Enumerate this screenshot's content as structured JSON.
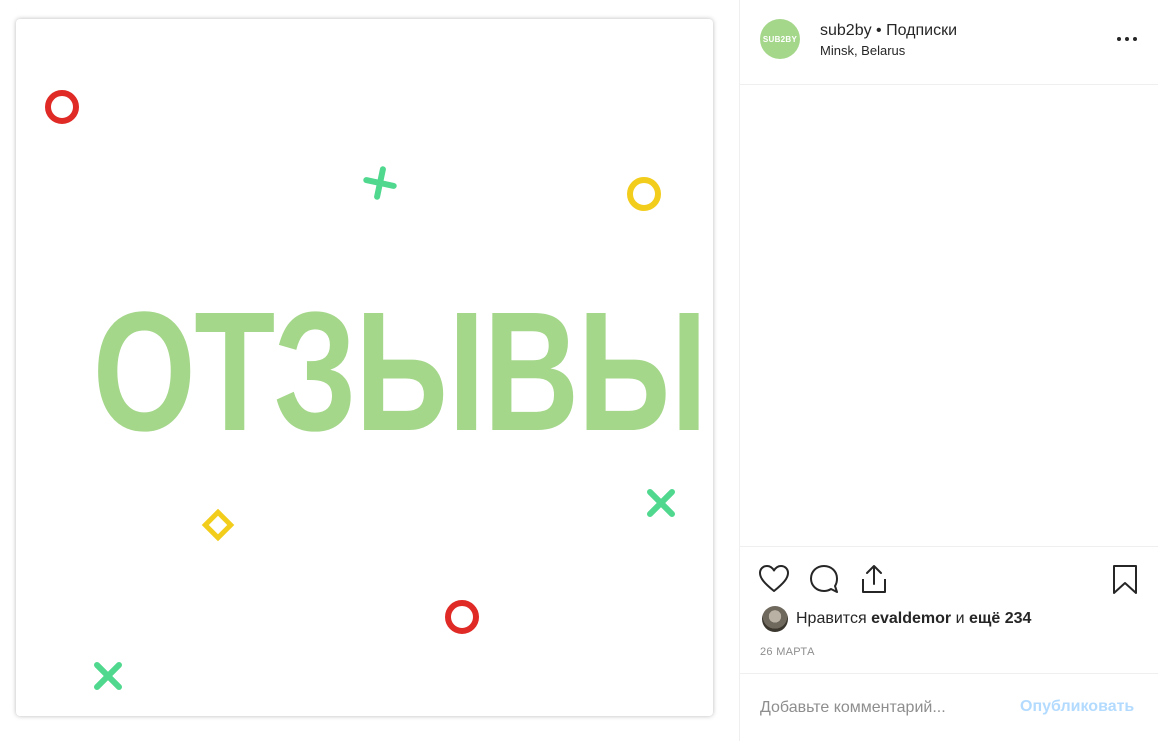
{
  "post": {
    "image_text": "ОТЗЫВЫ",
    "brand_color": "#a5d78b",
    "decorations": [
      "red-ring-icon",
      "green-cross-icon",
      "yellow-ring-icon",
      "green-cross-icon",
      "yellow-diamond-icon",
      "red-ring-icon",
      "green-cross-icon"
    ]
  },
  "header": {
    "avatar_text": "SUB2BY",
    "username": "sub2by",
    "separator": "•",
    "follow_status": "Подписки",
    "location": "Minsk, Belarus",
    "more_icon": "more-horizontal-icon"
  },
  "actions": {
    "like_icon": "heart-icon",
    "comment_icon": "comment-icon",
    "share_icon": "share-icon",
    "save_icon": "bookmark-icon"
  },
  "likes": {
    "prefix": "Нравится",
    "user": "evaldemor",
    "conjunction": "и",
    "others": "ещё 234"
  },
  "date": "26 МАРТА",
  "comment": {
    "placeholder": "Добавьте комментарий...",
    "publish_label": "Опубликовать"
  }
}
